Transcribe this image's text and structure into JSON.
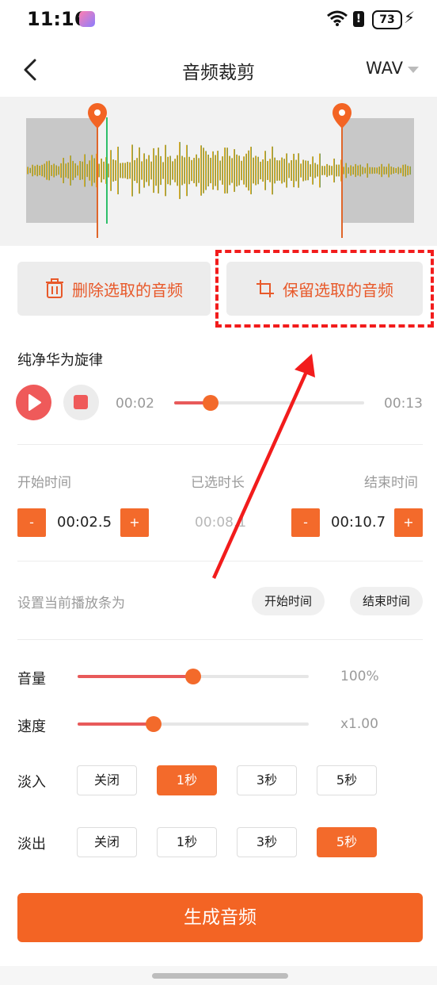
{
  "status_bar": {
    "time": "11:16",
    "battery": "73",
    "icons": [
      "app-badge-icon",
      "wifi-icon",
      "alert-icon",
      "battery-icon",
      "charging-icon"
    ]
  },
  "header": {
    "title": "音频裁剪",
    "format": "WAV"
  },
  "waveform": {
    "start_marker_fraction": 0.18,
    "end_marker_fraction": 0.81,
    "playhead_fraction": 0.21
  },
  "actions": {
    "delete_label": "删除选取的音频",
    "keep_label": "保留选取的音频"
  },
  "track": {
    "name": "纯净华为旋律",
    "current_time": "00:02",
    "total_time": "00:13",
    "progress": 0.19
  },
  "timing": {
    "start_label": "开始时间",
    "selected_label": "已选时长",
    "end_label": "结束时间",
    "start_value": "00:02.5",
    "selected_value": "00:08.1",
    "end_value": "00:10.7",
    "minus": "-",
    "plus": "+"
  },
  "set_playbar": {
    "label": "设置当前播放条为",
    "start_btn": "开始时间",
    "end_btn": "结束时间"
  },
  "volume": {
    "label": "音量",
    "value": "100%",
    "level": 0.5
  },
  "speed": {
    "label": "速度",
    "value": "x1.00",
    "level": 0.33
  },
  "fade_in": {
    "label": "淡入",
    "options": [
      "关闭",
      "1秒",
      "3秒",
      "5秒"
    ],
    "selected": 1
  },
  "fade_out": {
    "label": "淡出",
    "options": [
      "关闭",
      "1秒",
      "3秒",
      "5秒"
    ],
    "selected": 3
  },
  "generate_label": "生成音频",
  "colors": {
    "accent": "#f36424",
    "annotation": "#f21c1c",
    "slider": "#e85a5a"
  }
}
